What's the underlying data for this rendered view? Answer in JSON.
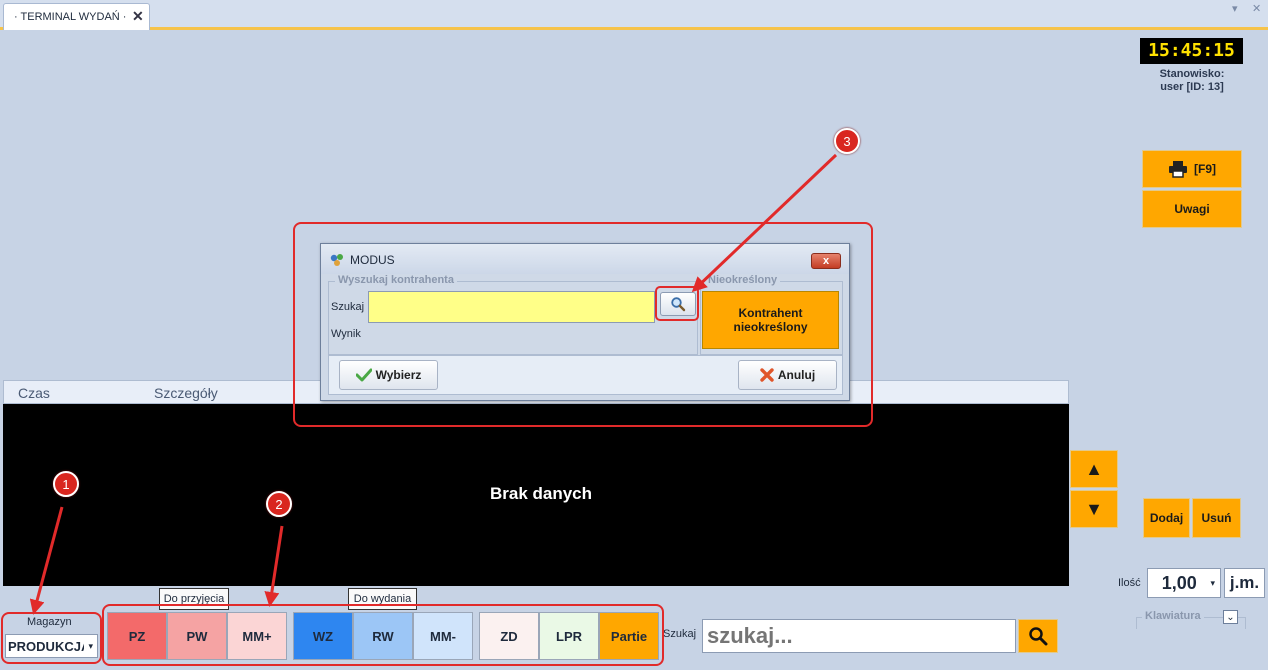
{
  "tab": {
    "title": "· TERMINAL WYDAŃ ·",
    "close": "✕"
  },
  "window_controls": {
    "dropdown": "▾",
    "close": "✕"
  },
  "clock": "15:45:15",
  "station": {
    "label": "Stanowisko:",
    "value": "user [ID: 13]"
  },
  "right_panel": {
    "print_label": "[F9]",
    "notes_label": "Uwagi",
    "add_label": "Dodaj",
    "remove_label": "Usuń",
    "up": "▲",
    "down": "▼"
  },
  "grid": {
    "columns": [
      "Czas",
      "Szczegóły"
    ],
    "empty_text": "Brak danych"
  },
  "quantity": {
    "label": "Ilość",
    "value": "1,00",
    "unit": "j.m."
  },
  "keyboard": {
    "label": "Klawiatura",
    "toggle": "⌄"
  },
  "warehouse": {
    "label": "Magazyn",
    "value": "PRODUKCJA"
  },
  "doc_groups": {
    "receipt_label": "Do przyjęcia",
    "issue_label": "Do wydania"
  },
  "doc_buttons": [
    {
      "label": "PZ",
      "color": "#f36a6a"
    },
    {
      "label": "PW",
      "color": "#f5a3a3"
    },
    {
      "label": "MM+",
      "color": "#fbd5d5"
    },
    {
      "label": "WZ",
      "color": "#2e86f0"
    },
    {
      "label": "RW",
      "color": "#9cc6f6"
    },
    {
      "label": "MM-",
      "color": "#d0e4fb"
    },
    {
      "label": "ZD",
      "color": "#fbf1f0"
    },
    {
      "label": "LPR",
      "color": "#eaf9e6"
    },
    {
      "label": "Partie",
      "color": "#ffa700"
    }
  ],
  "search": {
    "label": "Szukaj",
    "placeholder": "szukaj..."
  },
  "dialog": {
    "title": "MODUS",
    "close": "x",
    "search_group_title": "Wyszukaj kontrahenta",
    "search_label": "Szukaj",
    "search_value": "",
    "result_label": "Wynik",
    "undefined_group_title": "Nieokreślony",
    "undefined_button": "Kontrahent nieokreślony",
    "select_button": "Wybierz",
    "cancel_button": "Anuluj"
  },
  "annotations": [
    "1",
    "2",
    "3"
  ],
  "colors": {
    "accent_orange": "#ffa700",
    "annotation_red": "#e12a2a",
    "search_yellow": "#ffff88"
  }
}
